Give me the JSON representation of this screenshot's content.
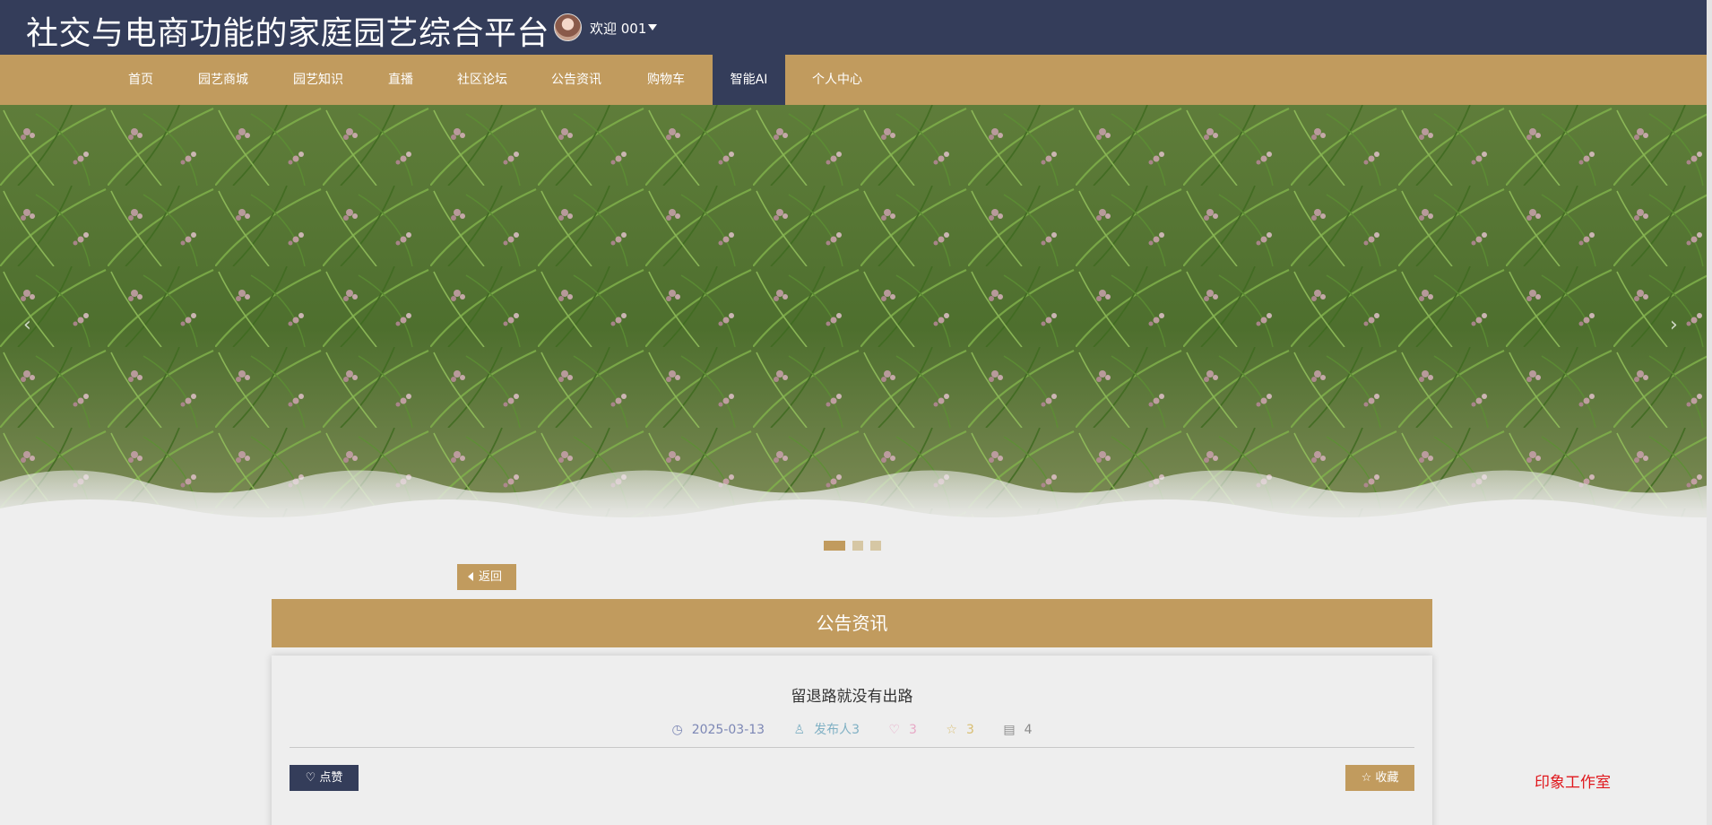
{
  "header": {
    "site_title": "社交与电商功能的家庭园艺综合平台",
    "welcome": "欢迎 001"
  },
  "nav": {
    "items": [
      {
        "label": "首页"
      },
      {
        "label": "园艺商城"
      },
      {
        "label": "园艺知识"
      },
      {
        "label": "直播"
      },
      {
        "label": "社区论坛"
      },
      {
        "label": "公告资讯"
      },
      {
        "label": "购物车"
      },
      {
        "label": "智能AI"
      },
      {
        "label": "个人中心"
      }
    ],
    "active": "智能AI"
  },
  "banner": {
    "prev_arrow": "‹",
    "next_arrow": "›",
    "slide_count": 3,
    "active_slide": 1
  },
  "back_button": {
    "label": "返回"
  },
  "section": {
    "title": "公告资讯"
  },
  "article": {
    "title": "留退路就没有出路",
    "date": "2025-03-13",
    "author": "发布人3",
    "likes": "3",
    "favorites": "3",
    "comments": "4",
    "like_button": "点赞",
    "favorite_button": "收藏"
  },
  "footer": {
    "studio": "印象工作室"
  },
  "colors": {
    "header_bg": "#343d5a",
    "nav_bg": "#c19b5e",
    "accent": "#c19b5e",
    "studio_text": "#e0171c"
  }
}
